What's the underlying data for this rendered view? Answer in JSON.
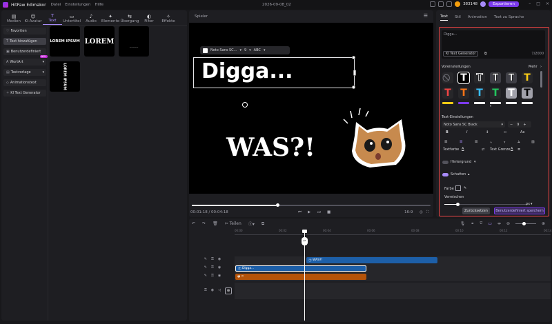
{
  "app": {
    "name": "HitPaw Edimakor",
    "menu": [
      "Datei",
      "Einstellungen",
      "Hilfe"
    ],
    "doc_title": "2026-09-08_02",
    "credits": "383148",
    "export": "Exportieren"
  },
  "toptabs": [
    {
      "label": "Medien",
      "icon": "▤"
    },
    {
      "label": "KI-Avatar",
      "icon": "☺"
    },
    {
      "label": "Text",
      "icon": "T"
    },
    {
      "label": "Untertitel",
      "icon": "▭"
    },
    {
      "label": "Audio",
      "icon": "♪"
    },
    {
      "label": "Elemente",
      "icon": "✦"
    },
    {
      "label": "Übergang",
      "icon": "⇆"
    },
    {
      "label": "Filter",
      "icon": "◐"
    },
    {
      "label": "Effekte",
      "icon": "✧"
    }
  ],
  "sidebar": [
    {
      "label": "Favoriten",
      "icon": "♡"
    },
    {
      "label": "Text hinzufügen",
      "icon": "T"
    },
    {
      "label": "Benutzerdefiniert",
      "icon": "▣"
    },
    {
      "label": "WortArt",
      "icon": "A",
      "badge": "NEU"
    },
    {
      "label": "Textvorlage",
      "icon": "▤"
    },
    {
      "label": "Animationstext",
      "icon": "◇"
    },
    {
      "label": "KI Text Generator",
      "icon": "✧"
    }
  ],
  "tiles": [
    {
      "label": "LOREM IPSUM"
    },
    {
      "label": "LOREM"
    },
    {
      "label": "LOREM IPSUM"
    }
  ],
  "player": {
    "title": "Spieler",
    "font": "Noto Sans SC...",
    "size": "9",
    "style": "ABC",
    "text1": "Digga...",
    "text2": "WAS?!",
    "time": "00:01:18 / 00:04:18",
    "ratio": "16:9"
  },
  "right": {
    "tabs": [
      "Text",
      "Stil",
      "Animation",
      "Text zu Sprache"
    ],
    "placeholder": "Digga...",
    "ai": "KI Text Generator",
    "counter": "7/2000",
    "presets": "Voreinstellungen",
    "mehr": "Mehr",
    "settings": "Text-Einstellungen",
    "font": "Noto Sans SC Black",
    "size": "9",
    "aa": "Aa",
    "textfarbe": "Textfarbe",
    "textgrenze": "Text Grenze",
    "hintergrund": "Hintergrund",
    "schatten": "Schatten",
    "farbe": "Farbe",
    "verwischen": "Verwischen",
    "blur_unit": "px",
    "reset": "Zurücksetzen",
    "save": "Benutzerdefiniert speichern"
  },
  "timeline": {
    "split": "Teilen",
    "ruler": [
      "00:00",
      "00:02",
      "00:04",
      "00:06",
      "00:08",
      "00:10",
      "00:12",
      "00:14"
    ],
    "clip1": "WAS?!",
    "clip2": "Digga..."
  },
  "colors": {
    "accent": "#7c3aed",
    "clip_blue": "#1d5fa8",
    "clip_orange": "#b45309",
    "highlight": "#ef4444"
  }
}
